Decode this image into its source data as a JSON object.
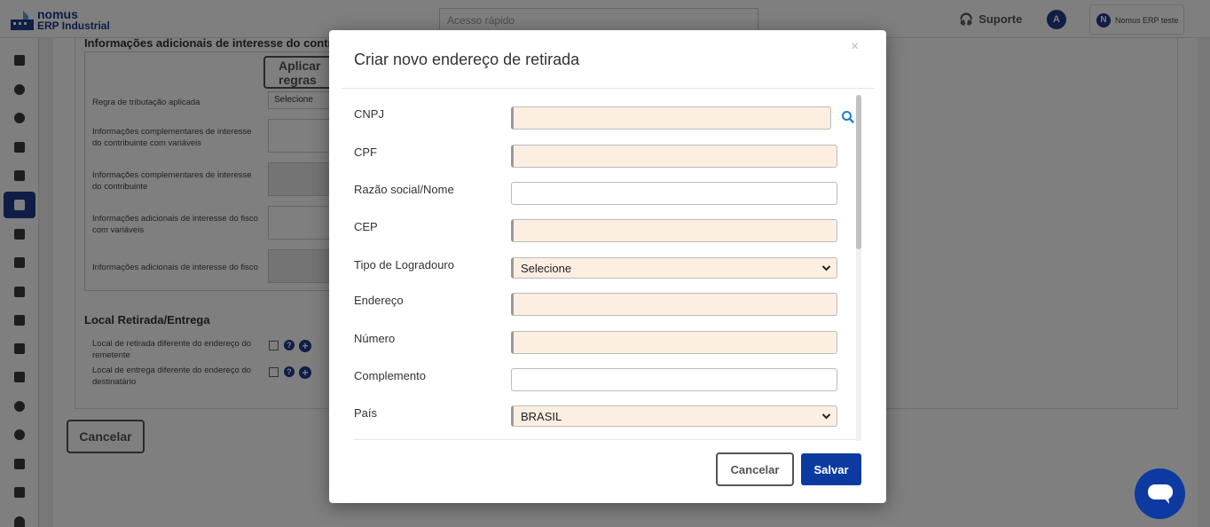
{
  "header": {
    "logo_top": "nomus",
    "logo_bottom": "ERP Industrial",
    "quick_access_placeholder": "Acesso rápido",
    "support_label": "Suporte",
    "avatar_initial": "A",
    "account_name": "Nomus ERP teste"
  },
  "sidebar": {
    "icons": [
      "book-icon",
      "user-icon",
      "gear-icon",
      "hierarchy-icon",
      "tools-icon",
      "briefcase-icon",
      "document-icon",
      "factory-icon",
      "chart-icon",
      "box-icon",
      "cart-icon",
      "crane-icon",
      "cogs-icon",
      "dollar-icon",
      "calculator-icon",
      "file-icon",
      "helmet-icon"
    ],
    "active_index": 5
  },
  "background_form": {
    "section_title": "Informações adicionais de interesse do contribuinte",
    "apply_button": "Aplicar regras",
    "tax_rule_label": "Regra de tributação aplicada",
    "tax_rule_value": "Selecione",
    "field_labels": [
      "Informações complementares de interesse do contribuinte com variáveis",
      "Informações complementares de interesse do contribuinte",
      "Informações adicionais de interesse do fisco com variáveis",
      "Informações adicionais de interesse do fisco"
    ],
    "pickup_section_title": "Local Retirada/Entrega",
    "pickup_label": "Local de retirada diferente do endereço do remetente",
    "delivery_label": "Local de entrega diferente do endereço do destinatário",
    "cancel_button": "Cancelar"
  },
  "modal": {
    "title": "Criar novo endereço de retirada",
    "close_symbol": "×",
    "fields": [
      {
        "label": "CNPJ",
        "value": "",
        "required": true,
        "type": "input"
      },
      {
        "label": "CPF",
        "value": "",
        "required": true,
        "type": "input"
      },
      {
        "label": "Razão social/Nome",
        "value": "",
        "required": false,
        "type": "input"
      },
      {
        "label": "CEP",
        "value": "",
        "required": true,
        "type": "input"
      },
      {
        "label": "Tipo de Logradouro",
        "value": "Selecione",
        "required": false,
        "type": "select"
      },
      {
        "label": "Endereço",
        "value": "",
        "required": true,
        "type": "input"
      },
      {
        "label": "Número",
        "value": "",
        "required": true,
        "type": "input"
      },
      {
        "label": "Complemento",
        "value": "",
        "required": false,
        "type": "input"
      },
      {
        "label": "País",
        "value": "BRASIL",
        "required": true,
        "type": "select"
      }
    ],
    "cancel_button": "Cancelar",
    "save_button": "Salvar"
  },
  "colors": {
    "brand": "#1f3a8f",
    "primary_button": "#0d3aa0",
    "required_field": "#fdeee2"
  }
}
